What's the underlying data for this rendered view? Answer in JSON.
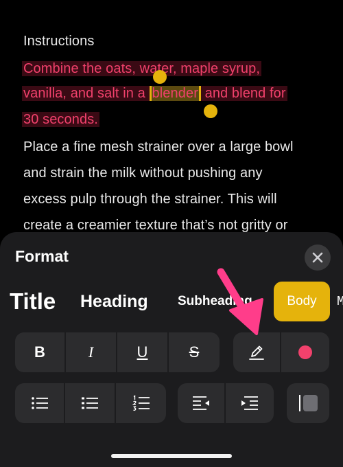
{
  "note": {
    "heading": "Instructions",
    "highlighted_lines": [
      "Combine the oats, water, maple syrup,",
      "vanilla, and salt in a ",
      " and blend for",
      "30 seconds."
    ],
    "selected_word": "blender",
    "body_lines": [
      "Place a fine mesh strainer over a large bowl",
      "and strain the milk without pushing any",
      "excess pulp through the strainer. This will",
      "create a creamier texture that’s not gritty or"
    ]
  },
  "format_sheet": {
    "title": "Format",
    "styles": [
      "Title",
      "Heading",
      "Subheading",
      "Body",
      "M"
    ],
    "selected_style": "Body",
    "text_buttons": {
      "bold": "B",
      "italic": "I",
      "underline": "U",
      "strikethrough": "S"
    },
    "icons": {
      "close": "close-icon",
      "pen": "pen-icon",
      "color": "color-dot-icon",
      "bullet_list": "bulleted-list-icon",
      "dashed_list": "dashed-list-icon",
      "numbered_list": "numbered-list-icon",
      "outdent": "decrease-indent-icon",
      "indent": "increase-indent-icon",
      "block_quote": "block-quote-icon"
    },
    "colors": {
      "accent": "#e5b30c",
      "highlight_text": "#f1416c",
      "color_dot": "#f1416c",
      "annotation_arrow": "#ff3d8a"
    }
  }
}
